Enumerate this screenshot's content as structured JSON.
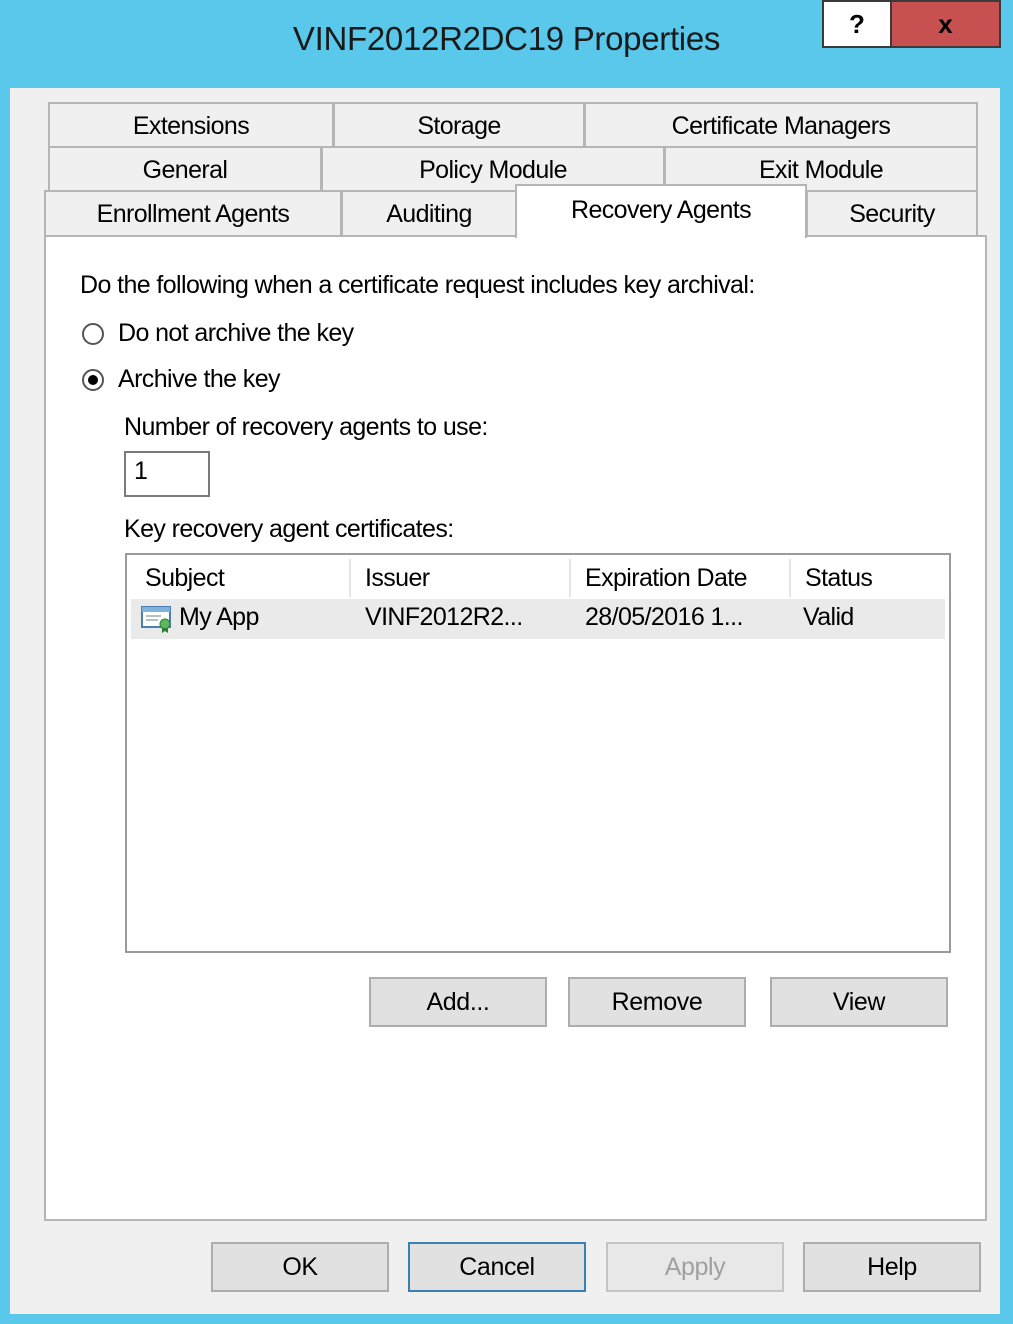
{
  "window": {
    "title": "VINF2012R2DC19 Properties",
    "help_label": "?",
    "close_label": "x"
  },
  "tabs": {
    "row1": [
      "Extensions",
      "Storage",
      "Certificate Managers"
    ],
    "row2": [
      "General",
      "Policy Module",
      "Exit Module"
    ],
    "row3": [
      "Enrollment Agents",
      "Auditing",
      "Recovery Agents",
      "Security"
    ],
    "active": "Recovery Agents"
  },
  "panel": {
    "instruction": "Do the following when a certificate request includes key archival:",
    "option_no_archive": "Do not archive the key",
    "option_archive": "Archive the key",
    "selected_option": "Archive the key",
    "num_agents_label": "Number of recovery agents to use:",
    "num_agents_value": "1",
    "certs_label": "Key recovery agent certificates:",
    "columns": [
      "Subject",
      "Issuer",
      "Expiration Date",
      "Status"
    ],
    "rows": [
      {
        "subject": "My App",
        "issuer": "VINF2012R2...",
        "expiration": "28/05/2016 1...",
        "status": "Valid"
      }
    ],
    "add_label": "Add...",
    "remove_label": "Remove",
    "view_label": "View"
  },
  "footer": {
    "ok_label": "OK",
    "cancel_label": "Cancel",
    "apply_label": "Apply",
    "help_label": "Help"
  },
  "colors": {
    "frame": "#5ac8ea",
    "close_button": "#c75050",
    "row_highlight": "#eaeaea"
  }
}
